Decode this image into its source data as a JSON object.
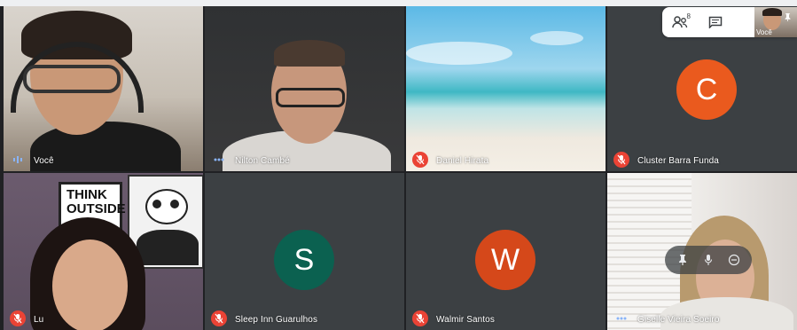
{
  "participants_count": "8",
  "self_label": "Você",
  "tiles": [
    {
      "name": "Você",
      "status": "talking"
    },
    {
      "name": "Nilton Cambé",
      "status": "talking"
    },
    {
      "name": "Daniel Hirata",
      "status": "muted"
    },
    {
      "name": "Cluster Barra Funda",
      "status": "muted",
      "avatar_letter": "C",
      "avatar_color": "#ea5a1e"
    },
    {
      "name": "Lu",
      "status": "muted",
      "poster_text": "THINK OUTSIDE"
    },
    {
      "name": "Sleep Inn Guarulhos",
      "status": "muted",
      "avatar_letter": "S",
      "avatar_color": "#0b6150"
    },
    {
      "name": "Walmir Santos",
      "status": "muted",
      "avatar_letter": "W",
      "avatar_color": "#d5481a"
    },
    {
      "name": "Giselle Vieira Soeiro",
      "status": "talking"
    }
  ],
  "colors": {
    "muted": "#ea4335",
    "talking": "#8ab4f8",
    "stage": "#202124",
    "tile": "#3c4043"
  }
}
